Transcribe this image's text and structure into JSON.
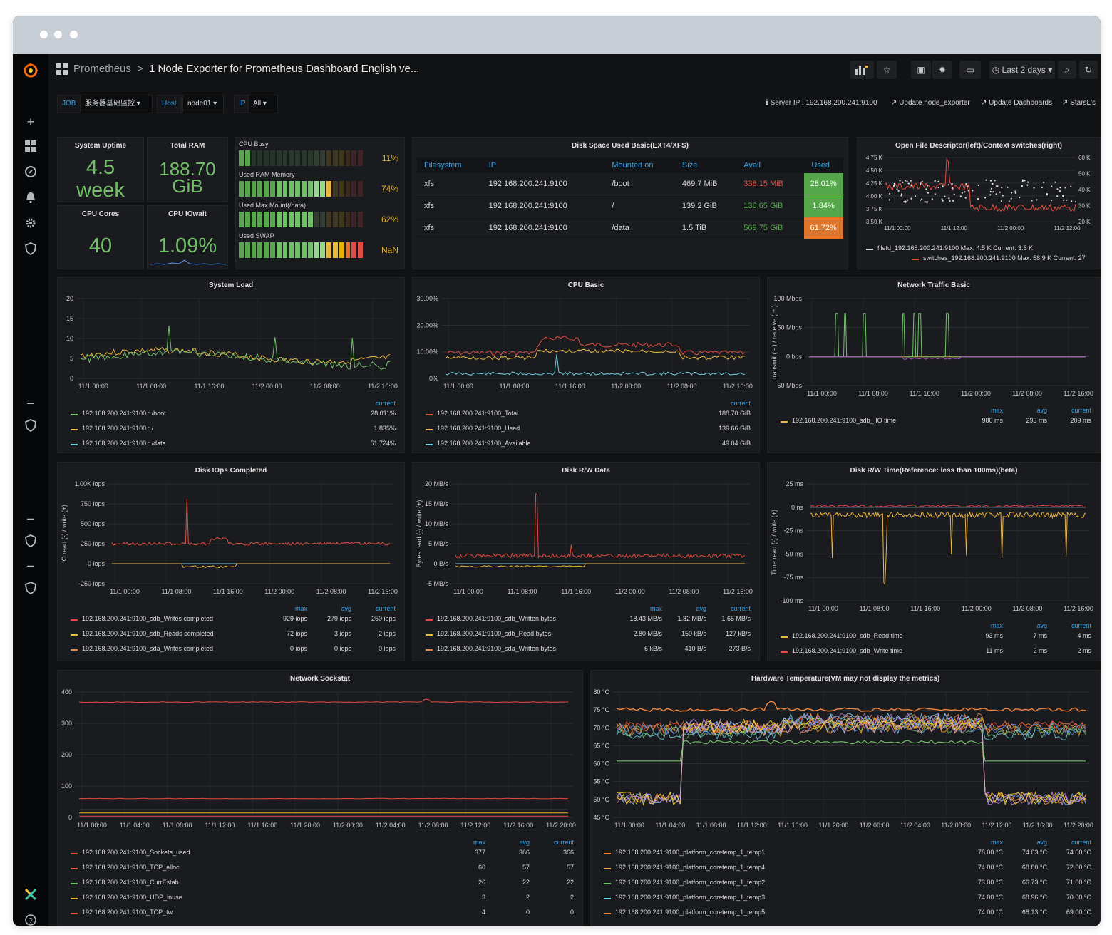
{
  "topbar": {
    "datasource": "Prometheus",
    "separator": ">",
    "dashboard_title": "1 Node Exporter for Prometheus Dashboard English ve...",
    "time_range": "Last 2 days"
  },
  "variables": [
    {
      "label": "JOB",
      "value": "服务器基础监控"
    },
    {
      "label": "Host",
      "value": "node01"
    },
    {
      "label": "IP",
      "value": "All"
    }
  ],
  "links": [
    "Server IP : 192.168.200.241:9100",
    "Update node_exporter",
    "Update Dashboards",
    "StarsL's"
  ],
  "stats": {
    "uptime": {
      "title": "System Uptime",
      "value": "4.5",
      "unit": "week"
    },
    "ram": {
      "title": "Total RAM",
      "value": "188.70",
      "unit": "GiB"
    },
    "cores": {
      "title": "CPU Cores",
      "value": "40"
    },
    "iowait": {
      "title": "CPU IOwait",
      "value": "1.09%"
    }
  },
  "bargauges": [
    {
      "label": "CPU Busy",
      "pct_text": "11%",
      "fraction": 0.11
    },
    {
      "label": "Used RAM Memory",
      "pct_text": "74%",
      "fraction": 0.74
    },
    {
      "label": "Used Max Mount(/data)",
      "pct_text": "62%",
      "fraction": 0.62
    },
    {
      "label": "Used SWAP",
      "pct_text": "NaN",
      "fraction": 1.0
    }
  ],
  "disk_space": {
    "title": "Disk Space Used Basic(EXT4/XFS)",
    "headers": [
      "Filesystem",
      "IP",
      "Mounted on",
      "Size",
      "Avail",
      "Used"
    ],
    "rows": [
      [
        "xfs",
        "192.168.200.241:9100",
        "/boot",
        "469.7 MiB",
        "338.15 MiB",
        "28.01%"
      ],
      [
        "xfs",
        "192.168.200.241:9100",
        "/",
        "139.2 GiB",
        "136.65 GiB",
        "1.84%"
      ],
      [
        "xfs",
        "192.168.200.241:9100",
        "/data",
        "1.5 TiB",
        "569.75 GiB",
        "61.72%"
      ]
    ],
    "used_colors": [
      "#56a64b",
      "#56a64b",
      "#e0752d"
    ]
  },
  "ofd": {
    "title": "Open File Descriptor(left)/Context switches(right)",
    "legend": [
      "filefd_192.168.200.241:9100  Max: 4.5 K  Current: 3.8 K",
      "switches_192.168.200.241:9100  Max: 58.9 K  Current: 27"
    ]
  },
  "panels": {
    "system_load": {
      "title": "System Load",
      "hdr": [
        "current"
      ],
      "legend": [
        {
          "name": "192.168.200.241:9100 : /boot",
          "values": [
            "28.011%"
          ],
          "color": "#73bf69"
        },
        {
          "name": "192.168.200.241:9100 : /",
          "values": [
            "1.835%"
          ],
          "color": "#eab839"
        },
        {
          "name": "192.168.200.241:9100 : /data",
          "values": [
            "61.724%"
          ],
          "color": "#6ed0e0"
        }
      ]
    },
    "cpu_basic": {
      "title": "CPU Basic",
      "hdr": [
        "current"
      ],
      "legend": [
        {
          "name": "192.168.200.241:9100_Total",
          "values": [
            "188.70 GiB"
          ],
          "color": "#e24d42"
        },
        {
          "name": "192.168.200.241:9100_Used",
          "values": [
            "139.66 GiB"
          ],
          "color": "#eab839"
        },
        {
          "name": "192.168.200.241:9100_Available",
          "values": [
            "49.04 GiB"
          ],
          "color": "#6ed0e0"
        }
      ]
    },
    "net_basic": {
      "title": "Network Traffic Basic",
      "hdr": [
        "max",
        "avg",
        "current"
      ],
      "legend": [
        {
          "name": "192.168.200.241:9100_sdb_ IO time",
          "values": [
            "980 ms",
            "293 ms",
            "209 ms"
          ],
          "color": "#eab839"
        }
      ]
    },
    "disk_iops": {
      "title": "Disk IOps Completed",
      "hdr": [
        "max",
        "avg",
        "current"
      ],
      "legend": [
        {
          "name": "192.168.200.241:9100_sdb_Writes completed",
          "values": [
            "929 iops",
            "279 iops",
            "250 iops"
          ],
          "color": "#e24d42"
        },
        {
          "name": "192.168.200.241:9100_sdb_Reads completed",
          "values": [
            "72 iops",
            "3 iops",
            "2 iops"
          ],
          "color": "#eab839"
        },
        {
          "name": "192.168.200.241:9100_sda_Writes completed",
          "values": [
            "0 iops",
            "0 iops",
            "0 iops"
          ],
          "color": "#ef843c"
        }
      ]
    },
    "disk_rw": {
      "title": "Disk R/W Data",
      "hdr": [
        "max",
        "avg",
        "current"
      ],
      "legend": [
        {
          "name": "192.168.200.241:9100_sdb_Written bytes",
          "values": [
            "18.43 MB/s",
            "1.82 MB/s",
            "1.65 MB/s"
          ],
          "color": "#e24d42"
        },
        {
          "name": "192.168.200.241:9100_sdb_Read bytes",
          "values": [
            "2.80 MB/s",
            "150 kB/s",
            "127 kB/s"
          ],
          "color": "#eab839"
        },
        {
          "name": "192.168.200.241:9100_sda_Written bytes",
          "values": [
            "6 kB/s",
            "410 B/s",
            "273 B/s"
          ],
          "color": "#ef843c"
        }
      ]
    },
    "disk_time": {
      "title": "Disk R/W Time(Reference: less than 100ms)(beta)",
      "hdr": [
        "max",
        "avg",
        "current"
      ],
      "legend": [
        {
          "name": "192.168.200.241:9100_sdb_Read time",
          "values": [
            "93 ms",
            "7 ms",
            "4 ms"
          ],
          "color": "#eab839"
        },
        {
          "name": "192.168.200.241:9100_sdb_Write time",
          "values": [
            "11 ms",
            "2 ms",
            "2 ms"
          ],
          "color": "#e24d42"
        }
      ]
    },
    "sockstat": {
      "title": "Network Sockstat",
      "hdr": [
        "max",
        "avg",
        "current"
      ],
      "legend": [
        {
          "name": "192.168.200.241:9100_Sockets_used",
          "values": [
            "377",
            "366",
            "366"
          ],
          "color": "#e24d42"
        },
        {
          "name": "192.168.200.241:9100_TCP_alloc",
          "values": [
            "60",
            "57",
            "57"
          ],
          "color": "#e24d42"
        },
        {
          "name": "192.168.200.241:9100_CurrEstab",
          "values": [
            "26",
            "22",
            "22"
          ],
          "color": "#73bf69"
        },
        {
          "name": "192.168.200.241:9100_UDP_inuse",
          "values": [
            "3",
            "2",
            "2"
          ],
          "color": "#eab839"
        },
        {
          "name": "192.168.200.241:9100_TCP_tw",
          "values": [
            "4",
            "0",
            "0"
          ],
          "color": "#e24d42"
        }
      ]
    },
    "temp": {
      "title": "Hardware Temperature(VM may not display the metrics)",
      "hdr": [
        "max",
        "avg",
        "current"
      ],
      "legend": [
        {
          "name": "192.168.200.241:9100_platform_coretemp_1_temp1",
          "values": [
            "78.00 °C",
            "74.03 °C",
            "74.00 °C"
          ],
          "color": "#ef843c"
        },
        {
          "name": "192.168.200.241:9100_platform_coretemp_1_temp4",
          "values": [
            "74.00 °C",
            "68.80 °C",
            "72.00 °C"
          ],
          "color": "#eab839"
        },
        {
          "name": "192.168.200.241:9100_platform_coretemp_1_temp2",
          "values": [
            "73.00 °C",
            "66.73 °C",
            "71.00 °C"
          ],
          "color": "#73bf69"
        },
        {
          "name": "192.168.200.241:9100_platform_coretemp_1_temp3",
          "values": [
            "74.00 °C",
            "68.96 °C",
            "70.00 °C"
          ],
          "color": "#6ed0e0"
        },
        {
          "name": "192.168.200.241:9100_platform_coretemp_1_temp5",
          "values": [
            "74.00 °C",
            "68.13 °C",
            "69.00 °C"
          ],
          "color": "#ef843c"
        }
      ]
    }
  },
  "chart_data": [
    {
      "type": "line",
      "title": "System Load",
      "yticks": [
        "20",
        "15",
        "10",
        "5",
        "0"
      ],
      "ylim": [
        0,
        20
      ],
      "xticks": [
        "11/1 00:00",
        "11/1 08:00",
        "11/1 16:00",
        "11/2 00:00",
        "11/2 08:00",
        "11/2 16:00"
      ],
      "series": [
        {
          "values_approx": [
            4,
            5,
            5,
            6,
            8,
            7,
            6,
            5,
            4,
            3
          ]
        }
      ]
    },
    {
      "type": "line",
      "title": "CPU Basic",
      "yticks": [
        "30.00%",
        "20.00%",
        "10.00%",
        "0%"
      ],
      "ylim": [
        0,
        30
      ],
      "xticks": [
        "11/1 00:00",
        "11/1 08:00",
        "11/1 16:00",
        "11/2 00:00",
        "11/2 08:00",
        "11/2 16:00"
      ]
    },
    {
      "type": "line",
      "title": "Network Traffic Basic",
      "yticks": [
        "100 Mbps",
        "50 Mbps",
        "0 bps",
        "-50 Mbps"
      ],
      "ylabel": "transmit ( - ) / receive ( + )",
      "xticks": [
        "11/1 00:00",
        "11/1 08:00",
        "11/1 16:00",
        "11/2 00:00",
        "11/2 08:00",
        "11/2 16:00"
      ]
    },
    {
      "type": "line",
      "title": "Disk IOps Completed",
      "yticks": [
        "1.00K iops",
        "750 iops",
        "500 iops",
        "250 iops",
        "0 iops",
        "-250 iops"
      ],
      "ylabel": "IO read (-) / write (+)",
      "xticks": [
        "11/1 00:00",
        "11/1 08:00",
        "11/1 16:00",
        "11/2 00:00",
        "11/2 08:00",
        "11/2 16:00"
      ]
    },
    {
      "type": "line",
      "title": "Disk R/W Data",
      "yticks": [
        "20 MB/s",
        "15 MB/s",
        "10 MB/s",
        "5 MB/s",
        "0 B/s",
        "-5 MB/s"
      ],
      "ylabel": "Bytes read (-) / write (+)",
      "xticks": [
        "11/1 00:00",
        "11/1 08:00",
        "11/1 16:00",
        "11/2 00:00",
        "11/2 08:00",
        "11/2 16:00"
      ]
    },
    {
      "type": "line",
      "title": "Disk R/W Time(Reference: less than 100ms)(beta)",
      "yticks": [
        "25 ms",
        "0 ns",
        "-25 ms",
        "-50 ms",
        "-75 ms",
        "-100 ms"
      ],
      "ylabel": "Time read (-) / write (+)",
      "xticks": [
        "11/1 00:00",
        "11/1 08:00",
        "11/1 16:00",
        "11/2 00:00",
        "11/2 08:00",
        "11/2 16:00"
      ]
    },
    {
      "type": "line",
      "title": "Network Sockstat",
      "yticks": [
        "400",
        "300",
        "200",
        "100",
        "0"
      ],
      "ylim": [
        0,
        400
      ],
      "xticks": [
        "11/1 00:00",
        "11/1 04:00",
        "11/1 08:00",
        "11/1 12:00",
        "11/1 16:00",
        "11/1 20:00",
        "11/2 00:00",
        "11/2 04:00",
        "11/2 08:00",
        "11/2 12:00",
        "11/2 16:00",
        "11/2 20:00"
      ]
    },
    {
      "type": "line",
      "title": "Hardware Temperature(VM may not display the metrics)",
      "yticks": [
        "80 °C",
        "75 °C",
        "70 °C",
        "65 °C",
        "60 °C",
        "55 °C",
        "50 °C",
        "45 °C"
      ],
      "ylim": [
        45,
        80
      ],
      "xticks": [
        "11/1 00:00",
        "11/1 04:00",
        "11/1 08:00",
        "11/1 12:00",
        "11/1 16:00",
        "11/1 20:00",
        "11/2 00:00",
        "11/2 04:00",
        "11/2 08:00",
        "11/2 12:00",
        "11/2 16:00",
        "11/2 20:00"
      ]
    },
    {
      "type": "line",
      "title": "Open File Descriptor(left)/Context switches(right)",
      "yticks": [
        "4.75 K",
        "4.50 K",
        "4.25 K",
        "4.00 K",
        "3.75 K",
        "3.50 K"
      ],
      "yticks_right": [
        "60 K",
        "50 K",
        "40 K",
        "30 K",
        "20 K"
      ],
      "xticks": [
        "11/1 00:00",
        "11/1 12:00",
        "11/2 00:00",
        "11/2 12:00"
      ]
    }
  ]
}
